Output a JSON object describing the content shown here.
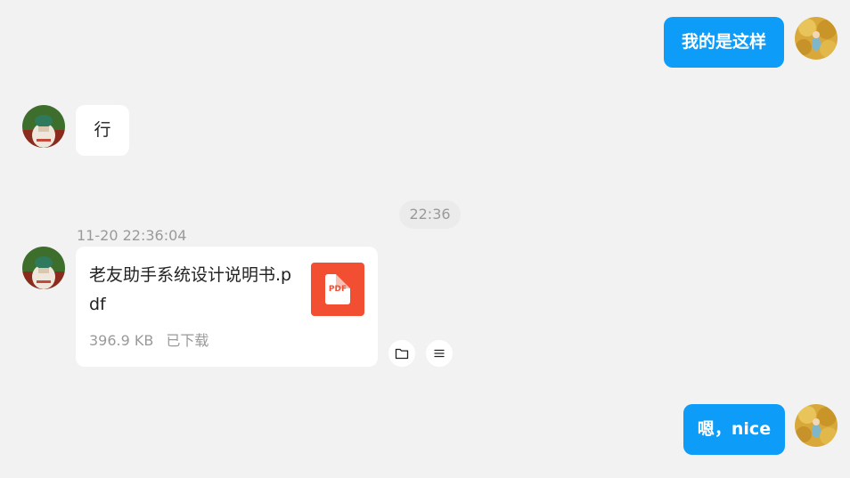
{
  "chat": {
    "messages": [
      {
        "direction": "outgoing",
        "type": "text",
        "text": "我的是这样"
      },
      {
        "direction": "incoming",
        "type": "text",
        "text": "行"
      },
      {
        "direction": "incoming",
        "type": "file",
        "timestamp": "11-20 22:36:04",
        "file": {
          "name": "老友助手系统设计说明书.pdf",
          "size": "396.9 KB",
          "status": "已下载",
          "icon_label": "PDF"
        }
      },
      {
        "direction": "outgoing",
        "type": "text",
        "text": "嗯，nice"
      }
    ],
    "time_divider": "22:36"
  },
  "icons": {
    "open_folder": "folder-icon",
    "more_menu": "menu-lines-icon",
    "file_type": "pdf-file-icon"
  },
  "colors": {
    "background": "#f2f2f2",
    "outgoing_bubble": "#0d9cf7",
    "incoming_bubble": "#ffffff",
    "pdf_icon": "#f14e32",
    "muted_text": "#9a9a9a"
  }
}
